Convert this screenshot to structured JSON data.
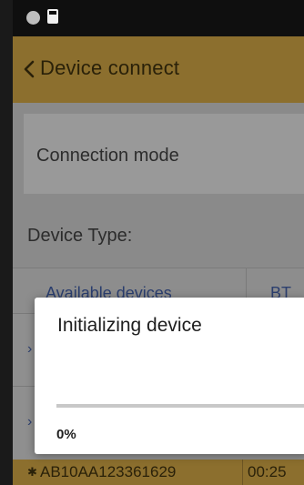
{
  "toolbar": {
    "title": "Device connect",
    "back_icon": "chevron-left-icon"
  },
  "statusbar": {
    "icons": [
      "circle-indicator-icon",
      "sd-card-icon"
    ]
  },
  "connection_mode": {
    "label": "Connection mode"
  },
  "device_type": {
    "label": "Device Type:"
  },
  "table": {
    "headers": [
      "Available devices",
      "BT"
    ],
    "rows": [
      {
        "arrow": "›"
      },
      {
        "arrow": "›"
      }
    ],
    "selected_row": {
      "name": "AB10AA123361629",
      "bt": "00:25",
      "icon": "bluetooth-icon"
    }
  },
  "dialog": {
    "title": "Initializing device",
    "progress_text": "0%",
    "progress_fraction": 0,
    "accent_color": "#8c6f2e"
  },
  "colors": {
    "toolbar": "#8c6f2e",
    "link": "#2b3e6e"
  }
}
